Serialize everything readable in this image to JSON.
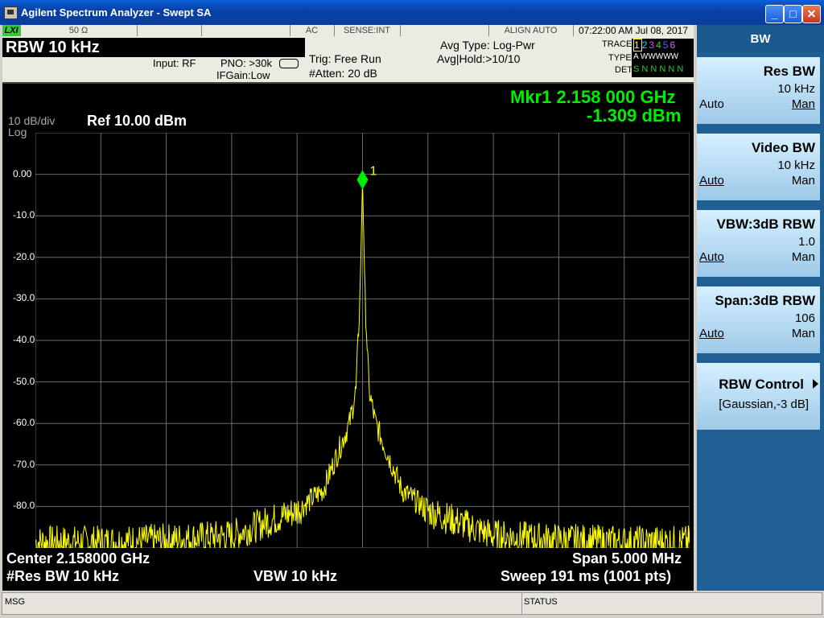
{
  "window": {
    "title": "Agilent Spectrum Analyzer - Swept SA",
    "buttons": {
      "minimize": "_",
      "maximize": "□",
      "close": "✕"
    }
  },
  "status_bar": {
    "lxi": "LXI",
    "impedance": "50 Ω",
    "coupling": "AC",
    "sense": "SENSE:INT",
    "align": "ALIGN AUTO",
    "datetime": "07:22:00 AM Jul 08, 2017"
  },
  "header": {
    "rbw_title": "RBW  10 kHz",
    "input": "Input: RF",
    "pno": "PNO: >30k",
    "ifgain": "IFGain:Low",
    "trig": "Trig: Free Run",
    "atten": "#Atten: 20 dB",
    "avg_type": "Avg Type: Log-Pwr",
    "avg_hold": "Avg|Hold:>10/10",
    "trace_label": "TRACE",
    "type_label": "TYPE",
    "det_label": "DET",
    "trace_nums": [
      "1",
      "2",
      "3",
      "4",
      "5",
      "6"
    ],
    "trace_colors": [
      "#ffff00",
      "#00e5ff",
      "#ff33ff",
      "#33cc33",
      "#4466ff",
      "#cc66ff"
    ],
    "type_value": "A WWWWW",
    "det_value": "S N N N N N"
  },
  "plot": {
    "scale": "10 dB/div",
    "scale_type": "Log",
    "ref": "Ref 10.00 dBm",
    "marker_freq": "Mkr1 2.158 000 GHz",
    "marker_amp": "-1.309 dBm",
    "marker_label": "1",
    "y_ticks": [
      "0.00",
      "-10.0",
      "-20.0",
      "-30.0",
      "-40.0",
      "-50.0",
      "-60.0",
      "-70.0",
      "-80.0"
    ],
    "center": "Center 2.158000 GHz",
    "span": "Span 5.000 MHz",
    "res_bw": "#Res BW 10 kHz",
    "vbw": "VBW 10 kHz",
    "sweep": "Sweep  191 ms (1001 pts)",
    "trace_color": "#ffff00",
    "marker_color": "#00ee00"
  },
  "softkeys": {
    "menu": "BW",
    "keys": [
      {
        "title": "Res BW",
        "value": "10 kHz",
        "auto": "Auto",
        "man": "Man"
      },
      {
        "title": "Video BW",
        "value": "10 kHz",
        "auto": "Auto",
        "man": "Man"
      },
      {
        "title": "VBW:3dB RBW",
        "value": "1.0",
        "auto": "Auto",
        "man": "Man"
      },
      {
        "title": "Span:3dB RBW",
        "value": "106",
        "auto": "Auto",
        "man": "Man"
      },
      {
        "title": "RBW Control",
        "value": "[Gaussian,-3 dB]"
      }
    ]
  },
  "bottom": {
    "msg": "MSG",
    "status": "STATUS"
  },
  "chart_data": {
    "type": "line",
    "title": "",
    "xlabel": "",
    "ylabel": "",
    "x_center_ghz": 2.158,
    "x_span_mhz": 5.0,
    "ylim": [
      -90,
      10
    ],
    "x": [
      -2.5,
      -2.0,
      -1.5,
      -1.0,
      -0.5,
      -0.3,
      -0.1,
      -0.05,
      -0.02,
      0.0,
      0.02,
      0.05,
      0.1,
      0.3,
      0.5,
      1.0,
      1.5,
      2.0,
      2.5
    ],
    "series": [
      {
        "values": [
          -88.5,
          -88.5,
          -88,
          -87,
          -81,
          -76,
          -60,
          -52,
          -30,
          -1.309,
          -30,
          -52,
          -60,
          -76,
          -81,
          -87,
          -88,
          -88.5,
          -88.5
        ]
      }
    ],
    "marker": {
      "x_mhz_offset": 0.0,
      "y": -1.309
    }
  }
}
